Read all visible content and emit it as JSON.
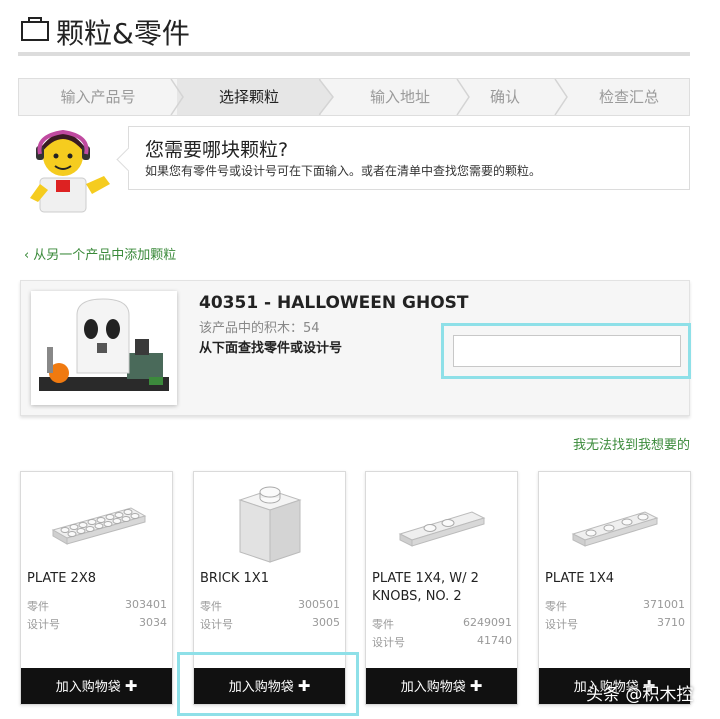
{
  "header": {
    "title": "颗粒&零件"
  },
  "steps": [
    {
      "label": "输入产品号",
      "active": false
    },
    {
      "label": "选择颗粒",
      "active": true
    },
    {
      "label": "输入地址",
      "active": false
    },
    {
      "label": "确认",
      "active": false
    },
    {
      "label": "检查汇总",
      "active": false
    }
  ],
  "guide": {
    "title": "您需要哪块颗粒?",
    "text": "如果您有零件号或设计号可在下面输入。或者在清单中查找您需要的颗粒。"
  },
  "back_link": "从另一个产品中添加颗粒",
  "product": {
    "name": "40351 - HALLOWEEN GHOST",
    "count": "该产品中的积木：54",
    "hint": "从下面查找零件或设计号",
    "search_value": ""
  },
  "cant_find": "我无法找到我想要的",
  "cards": [
    {
      "name": "PLATE 2X8",
      "part_label": "零件",
      "part": "303401",
      "design_label": "设计号",
      "design": "3034",
      "button": "加入购物袋"
    },
    {
      "name": "BRICK 1X1",
      "part_label": "零件",
      "part": "300501",
      "design_label": "设计号",
      "design": "3005",
      "button": "加入购物袋"
    },
    {
      "name": "PLATE 1X4, W/ 2 KNOBS, NO. 2",
      "part_label": "零件",
      "part": "6249091",
      "design_label": "设计号",
      "design": "41740",
      "button": "加入购物袋"
    },
    {
      "name": "PLATE 1X4",
      "part_label": "零件",
      "part": "371001",
      "design_label": "设计号",
      "design": "3710",
      "button": "加入购物袋"
    }
  ],
  "watermark": "头条 @积木控",
  "colors": {
    "link_green": "#3a8a3a",
    "highlight_cyan": "#8ee0e8",
    "button_black": "#111111"
  },
  "icons": [
    "bag-icon",
    "chevron-left-icon",
    "plus-icon",
    "minifigure-avatar"
  ]
}
